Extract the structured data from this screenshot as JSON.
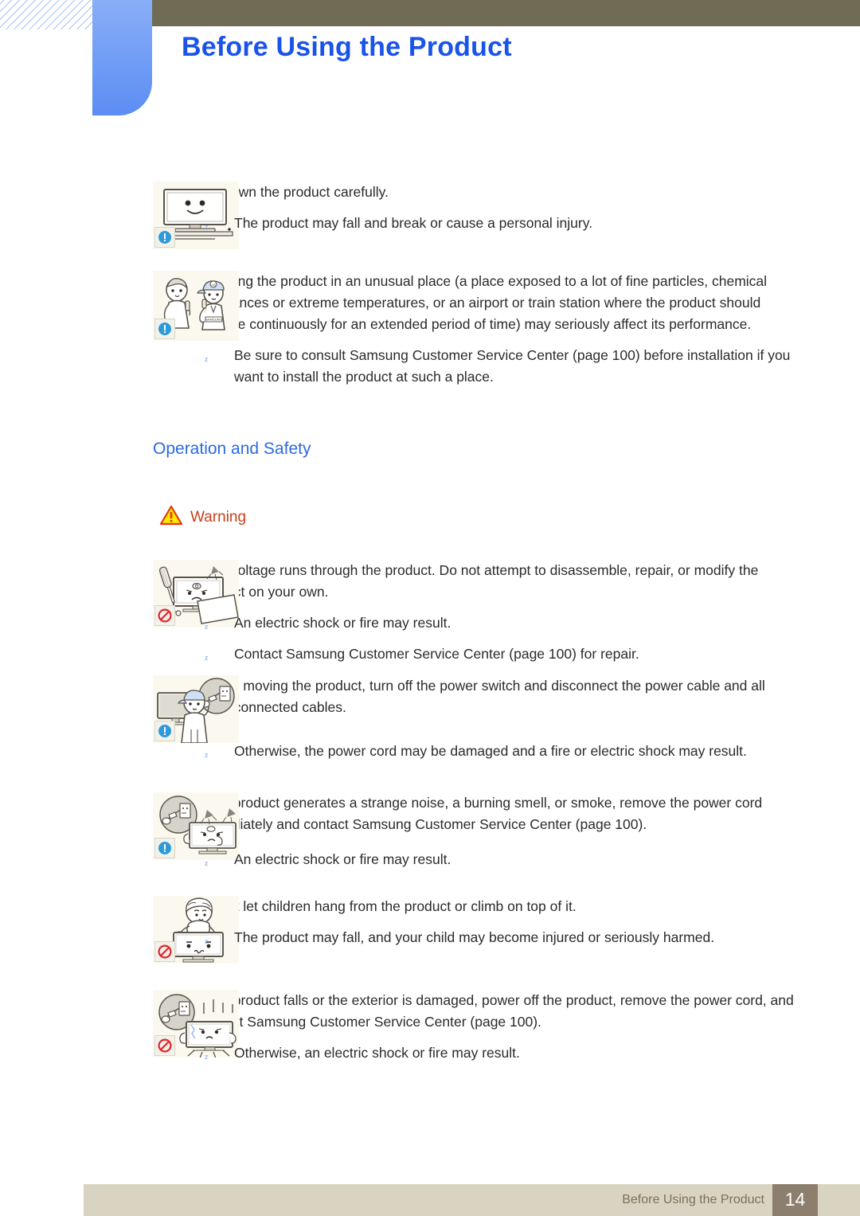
{
  "header": {
    "title": "Before Using the Product",
    "title_color": "#1a53e8",
    "bar_color": "#706b55",
    "tab_color": "#6f9cf5"
  },
  "sections": [
    {
      "id": "put-down",
      "illustration": "monitor-placed-on-stand",
      "badge": "info-icon",
      "paragraph": "Put down the product carefully.",
      "bullets": [
        "The product may fall and break or cause a personal injury."
      ]
    },
    {
      "id": "unusual-place",
      "illustration": "customer-service-call",
      "badge": "info-icon",
      "paragraph": "Installing the product in an unusual place (a place exposed to a lot of fine particles, chemical substances or extreme temperatures, or an airport or train station where the product should operate continuously for an extended period of time) may seriously affect its performance.",
      "bullets": [
        "Be sure to consult Samsung Customer Service Center (page 100) before installation if you want to install the product at such a place."
      ]
    }
  ],
  "operation_heading": "Operation and Safety",
  "warning": {
    "label": "Warning",
    "icon": "warning-triangle-icon",
    "triangle_fill": "#ffe600",
    "triangle_stroke": "#e23a12",
    "label_color": "#c8401b"
  },
  "warning_items": [
    {
      "id": "high-voltage",
      "illustration": "do-not-disassemble-monitor",
      "badge": "prohibition-icon",
      "paragraph": "High voltage runs through the product. Do not attempt to disassemble, repair, or modify the product on your own.",
      "bullets": [
        "An electric shock or fire may result.",
        "Contact Samsung Customer Service Center (page 100) for repair."
      ]
    },
    {
      "id": "before-moving",
      "illustration": "person-unplugging-power-cable",
      "badge": "info-icon",
      "paragraph": "Before moving the product, turn off the power switch and disconnect the power cable and all other connected cables.",
      "bullets": [
        "Otherwise, the power cord may be damaged and a fire or electric shock may result."
      ]
    },
    {
      "id": "strange-noise",
      "illustration": "monitor-smoking-unplug",
      "badge": "info-icon",
      "paragraph": "If the product generates a strange noise, a burning smell, or smoke, remove the power cord immediately and contact Samsung Customer Service Center (page 100).",
      "bullets": [
        "An electric shock or fire may result."
      ]
    },
    {
      "id": "children-hang",
      "illustration": "child-climbing-on-monitor",
      "badge": "prohibition-icon",
      "paragraph": "Do not let children hang from the product or climb on top of it.",
      "bullets": [
        "The product may fall, and your child may become injured or seriously harmed."
      ]
    },
    {
      "id": "product-falls",
      "illustration": "monitor-falling-damaged",
      "badge": "prohibition-icon",
      "paragraph": "If the product falls or the exterior is damaged, power off the product, remove the power cord, and contact Samsung Customer Service Center (page 100).",
      "bullets": [
        "Otherwise, an electric shock or fire may result."
      ]
    }
  ],
  "bullet_marker": "z",
  "footer": {
    "text": "Before Using the Product",
    "page_number": "14",
    "bar_color": "#d9d4c1",
    "page_box_color": "#8d7f6e"
  }
}
